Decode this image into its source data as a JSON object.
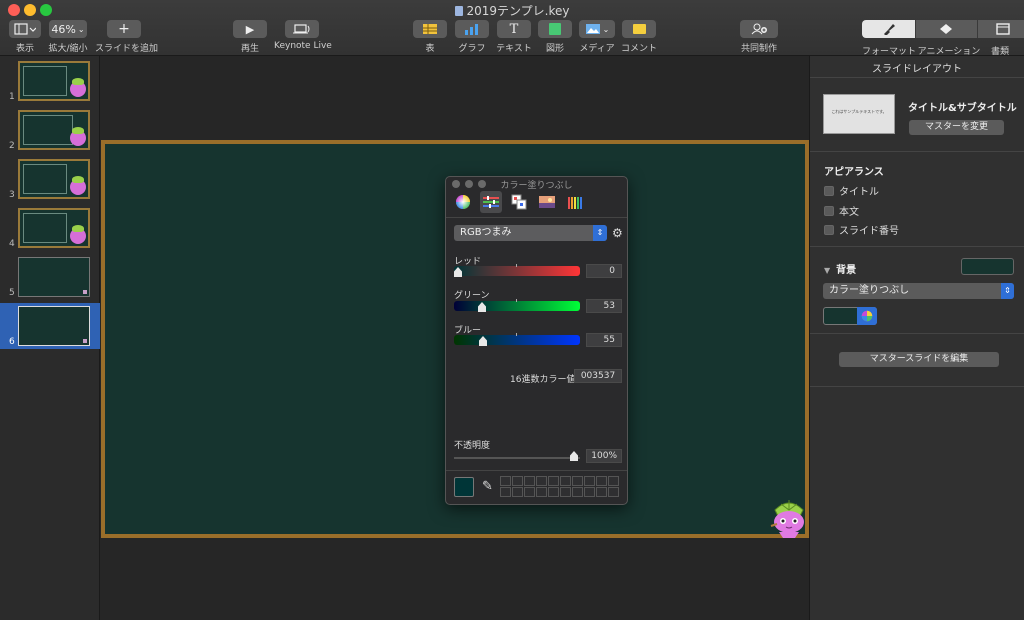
{
  "window": {
    "title": "2019テンプレ.key"
  },
  "toolbar": {
    "view_label": "表示",
    "zoom_value": "46%",
    "zoom_label": "拡大/縮小",
    "add_slide_label": "スライドを追加",
    "play_label": "再生",
    "keynote_live_label": "Keynote Live",
    "table_label": "表",
    "chart_label": "グラフ",
    "text_label": "テキスト",
    "shape_label": "図形",
    "media_label": "メディア",
    "comment_label": "コメント",
    "collaborate_label": "共同制作",
    "format_label": "フォーマット",
    "animate_label": "アニメーション",
    "document_label": "書類"
  },
  "slides": [
    {
      "number": "1"
    },
    {
      "number": "2"
    },
    {
      "number": "3"
    },
    {
      "number": "4"
    },
    {
      "number": "5"
    },
    {
      "number": "6"
    }
  ],
  "color_panel": {
    "title": "カラー塗りつぶし",
    "mode": "RGBつまみ",
    "red_label": "レッド",
    "red_value": "0",
    "green_label": "グリーン",
    "green_value": "53",
    "blue_label": "ブルー",
    "blue_value": "55",
    "hex_label": "16進数カラー値",
    "hex_value": "003537",
    "opacity_label": "不透明度",
    "opacity_value": "100%"
  },
  "inspector": {
    "title": "スライドレイアウト",
    "master_thumb_text": "これはサンプルテキストです。",
    "master_name": "タイトル&サブタイトル",
    "change_master": "マスターを変更",
    "appearance_heading": "アピアランス",
    "title_check": "タイトル",
    "body_check": "本文",
    "slide_number_check": "スライド番号",
    "background_heading": "背景",
    "fill_type": "カラー塗りつぶし",
    "edit_master": "マスタースライドを編集"
  },
  "colors": {
    "slide_bg": "#16342f",
    "slide_border": "#9a6e2a",
    "accent": "#2f6fd6"
  }
}
